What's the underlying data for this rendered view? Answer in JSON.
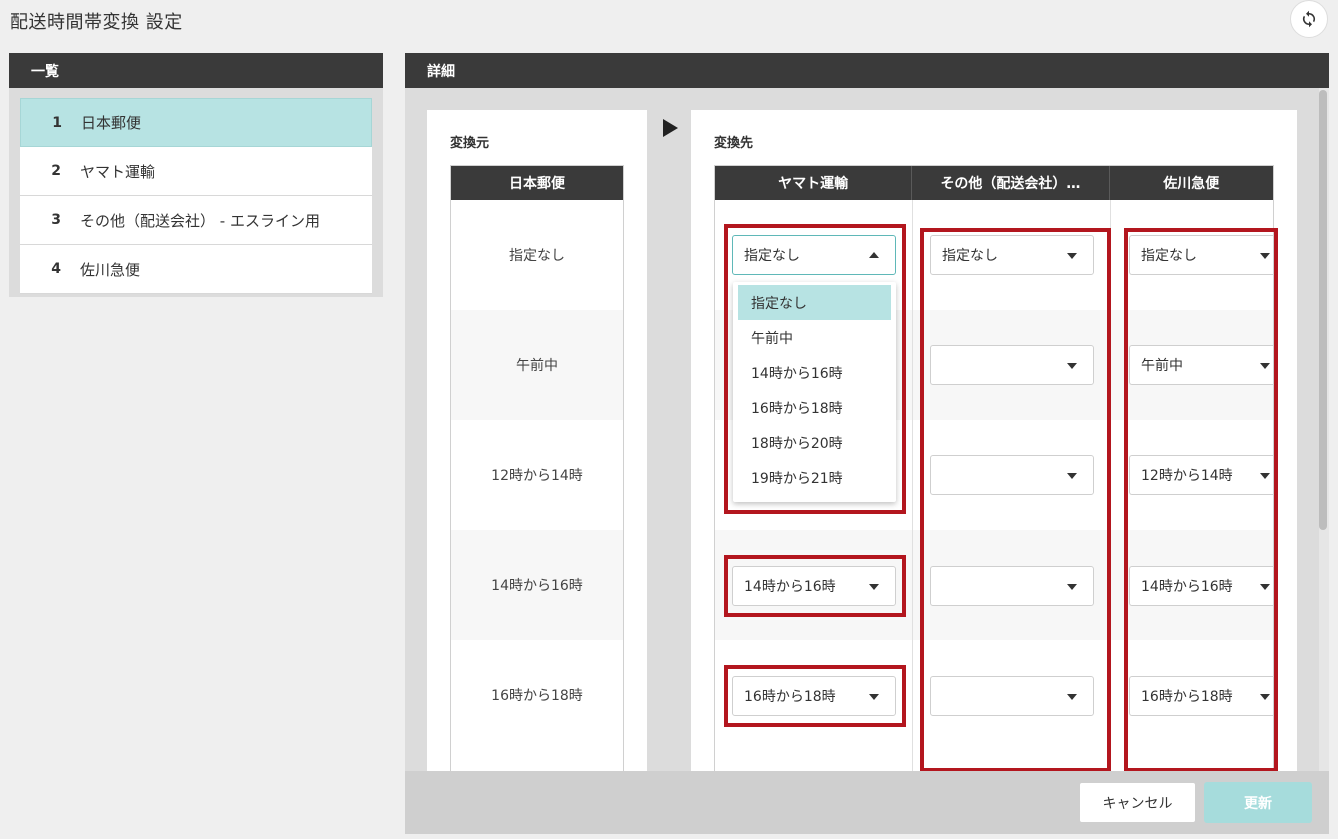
{
  "page": {
    "title": "配送時間帯変換 設定"
  },
  "list": {
    "header": "一覧",
    "items": [
      {
        "num": "1",
        "label": "日本郵便",
        "selected": true
      },
      {
        "num": "2",
        "label": "ヤマト運輸",
        "selected": false
      },
      {
        "num": "3",
        "label": "その他（配送会社） - エスライン用",
        "selected": false
      },
      {
        "num": "4",
        "label": "佐川急便",
        "selected": false
      }
    ]
  },
  "detail": {
    "header": "詳細",
    "source_label": "変換元",
    "dest_label": "変換先",
    "source_column": "日本郵便",
    "source_rows": [
      "指定なし",
      "午前中",
      "12時から14時",
      "14時から16時",
      "16時から18時"
    ],
    "dest_columns": [
      "ヤマト運輸",
      "その他（配送会社）…",
      "佐川急便"
    ],
    "yamato_values": [
      "指定なし",
      "",
      "",
      "14時から16時",
      "16時から18時"
    ],
    "other_values": [
      "指定なし",
      "",
      "",
      "",
      ""
    ],
    "sagawa_values": [
      "指定なし",
      "午前中",
      "12時から14時",
      "14時から16時",
      "16時から18時"
    ],
    "dropdown_options": [
      "指定なし",
      "午前中",
      "14時から16時",
      "16時から18時",
      "18時から20時",
      "19時から21時"
    ],
    "dropdown_selected": "指定なし"
  },
  "footer": {
    "cancel_label": "キャンセル",
    "update_label": "更新"
  },
  "colors": {
    "header_bg": "#3a3a3a",
    "selected_bg": "#b7e3e3",
    "highlight": "#b3161e",
    "update_btn": "#a6dcdc"
  }
}
